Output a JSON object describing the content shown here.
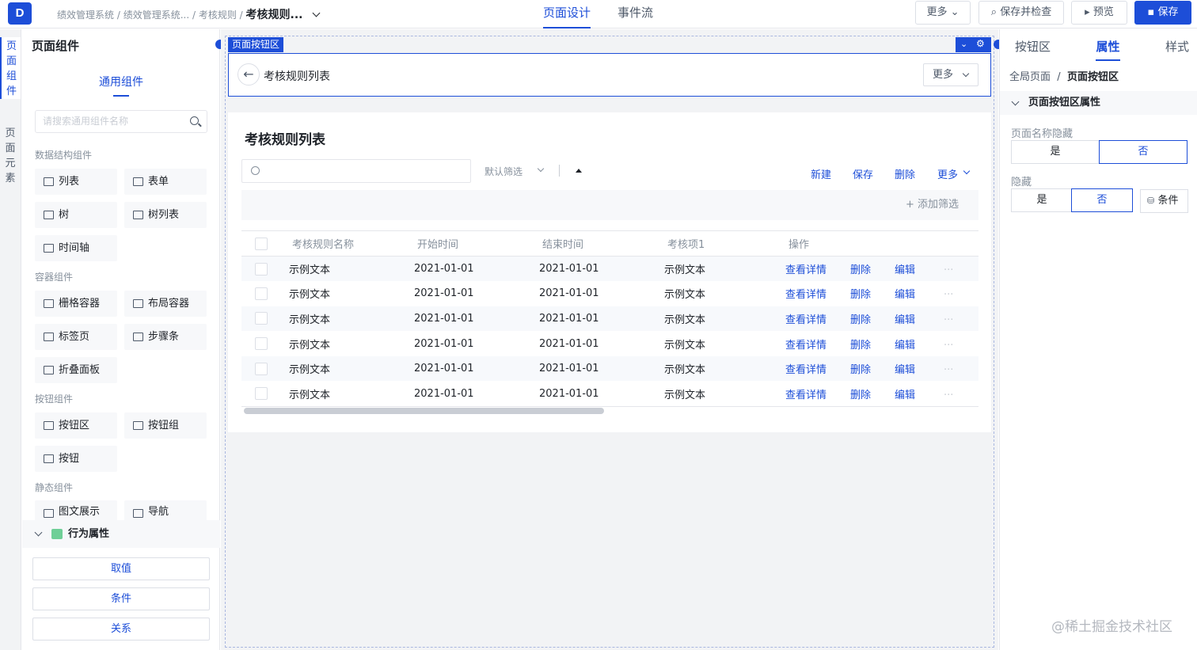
{
  "topbar": {
    "logo": "D",
    "breadcrumb": [
      "绩效管理系统",
      "绩效管理系统...",
      "考核规则"
    ],
    "current": "考核规则...",
    "tabs": [
      "页面设计",
      "事件流"
    ],
    "buttons": {
      "more": "更多",
      "save_check": "保存并检查",
      "preview": "预览",
      "save": "保存"
    }
  },
  "vtabs": [
    "页面组件",
    "页面元素"
  ],
  "left": {
    "title": "页面组件",
    "tab": "通用组件",
    "search_placeholder": "请搜索通用组件名称",
    "groups": [
      {
        "title": "数据结构组件",
        "items": [
          "列表",
          "表单",
          "树",
          "树列表",
          "时间轴"
        ]
      },
      {
        "title": "容器组件",
        "items": [
          "栅格容器",
          "布局容器",
          "标签页",
          "步骤条",
          "折叠面板"
        ]
      },
      {
        "title": "按钮组件",
        "items": [
          "按钮区",
          "按钮组",
          "按钮"
        ]
      },
      {
        "title": "静态组件",
        "items": [
          "图文展示",
          "导航"
        ]
      }
    ],
    "behavior_title": "行为属性",
    "behavior_buttons": [
      "取值",
      "条件",
      "关系"
    ]
  },
  "canvas": {
    "selected_label": "页面按钮区",
    "page_title": "考核规则列表",
    "more": "更多",
    "card_title": "考核规则列表",
    "filter": "默认筛选",
    "actions": [
      "新建",
      "保存",
      "删除"
    ],
    "actions_more": "更多",
    "add_filter": "+ 添加筛选",
    "columns": [
      "考核规则名称",
      "开始时间",
      "结束时间",
      "考核项1",
      "操作"
    ],
    "rows": [
      [
        "示例文本",
        "2021-01-01",
        "2021-01-01",
        "示例文本"
      ],
      [
        "示例文本",
        "2021-01-01",
        "2021-01-01",
        "示例文本"
      ],
      [
        "示例文本",
        "2021-01-01",
        "2021-01-01",
        "示例文本"
      ],
      [
        "示例文本",
        "2021-01-01",
        "2021-01-01",
        "示例文本"
      ],
      [
        "示例文本",
        "2021-01-01",
        "2021-01-01",
        "示例文本"
      ],
      [
        "示例文本",
        "2021-01-01",
        "2021-01-01",
        "示例文本"
      ]
    ],
    "row_ops": [
      "查看详情",
      "删除",
      "编辑",
      "···"
    ]
  },
  "right": {
    "tabs": [
      "按钮区",
      "属性",
      "样式"
    ],
    "active_tab": "属性",
    "crumb_root": "全局页面",
    "crumb_current": "页面按钮区",
    "section": "页面按钮区属性",
    "hide_name_label": "页面名称隐藏",
    "hide_label": "隐藏",
    "yes": "是",
    "no": "否",
    "condition": "条件"
  },
  "watermark": "@稀土掘金技术社区",
  "colors": {
    "accent": "#1d4ed8"
  }
}
